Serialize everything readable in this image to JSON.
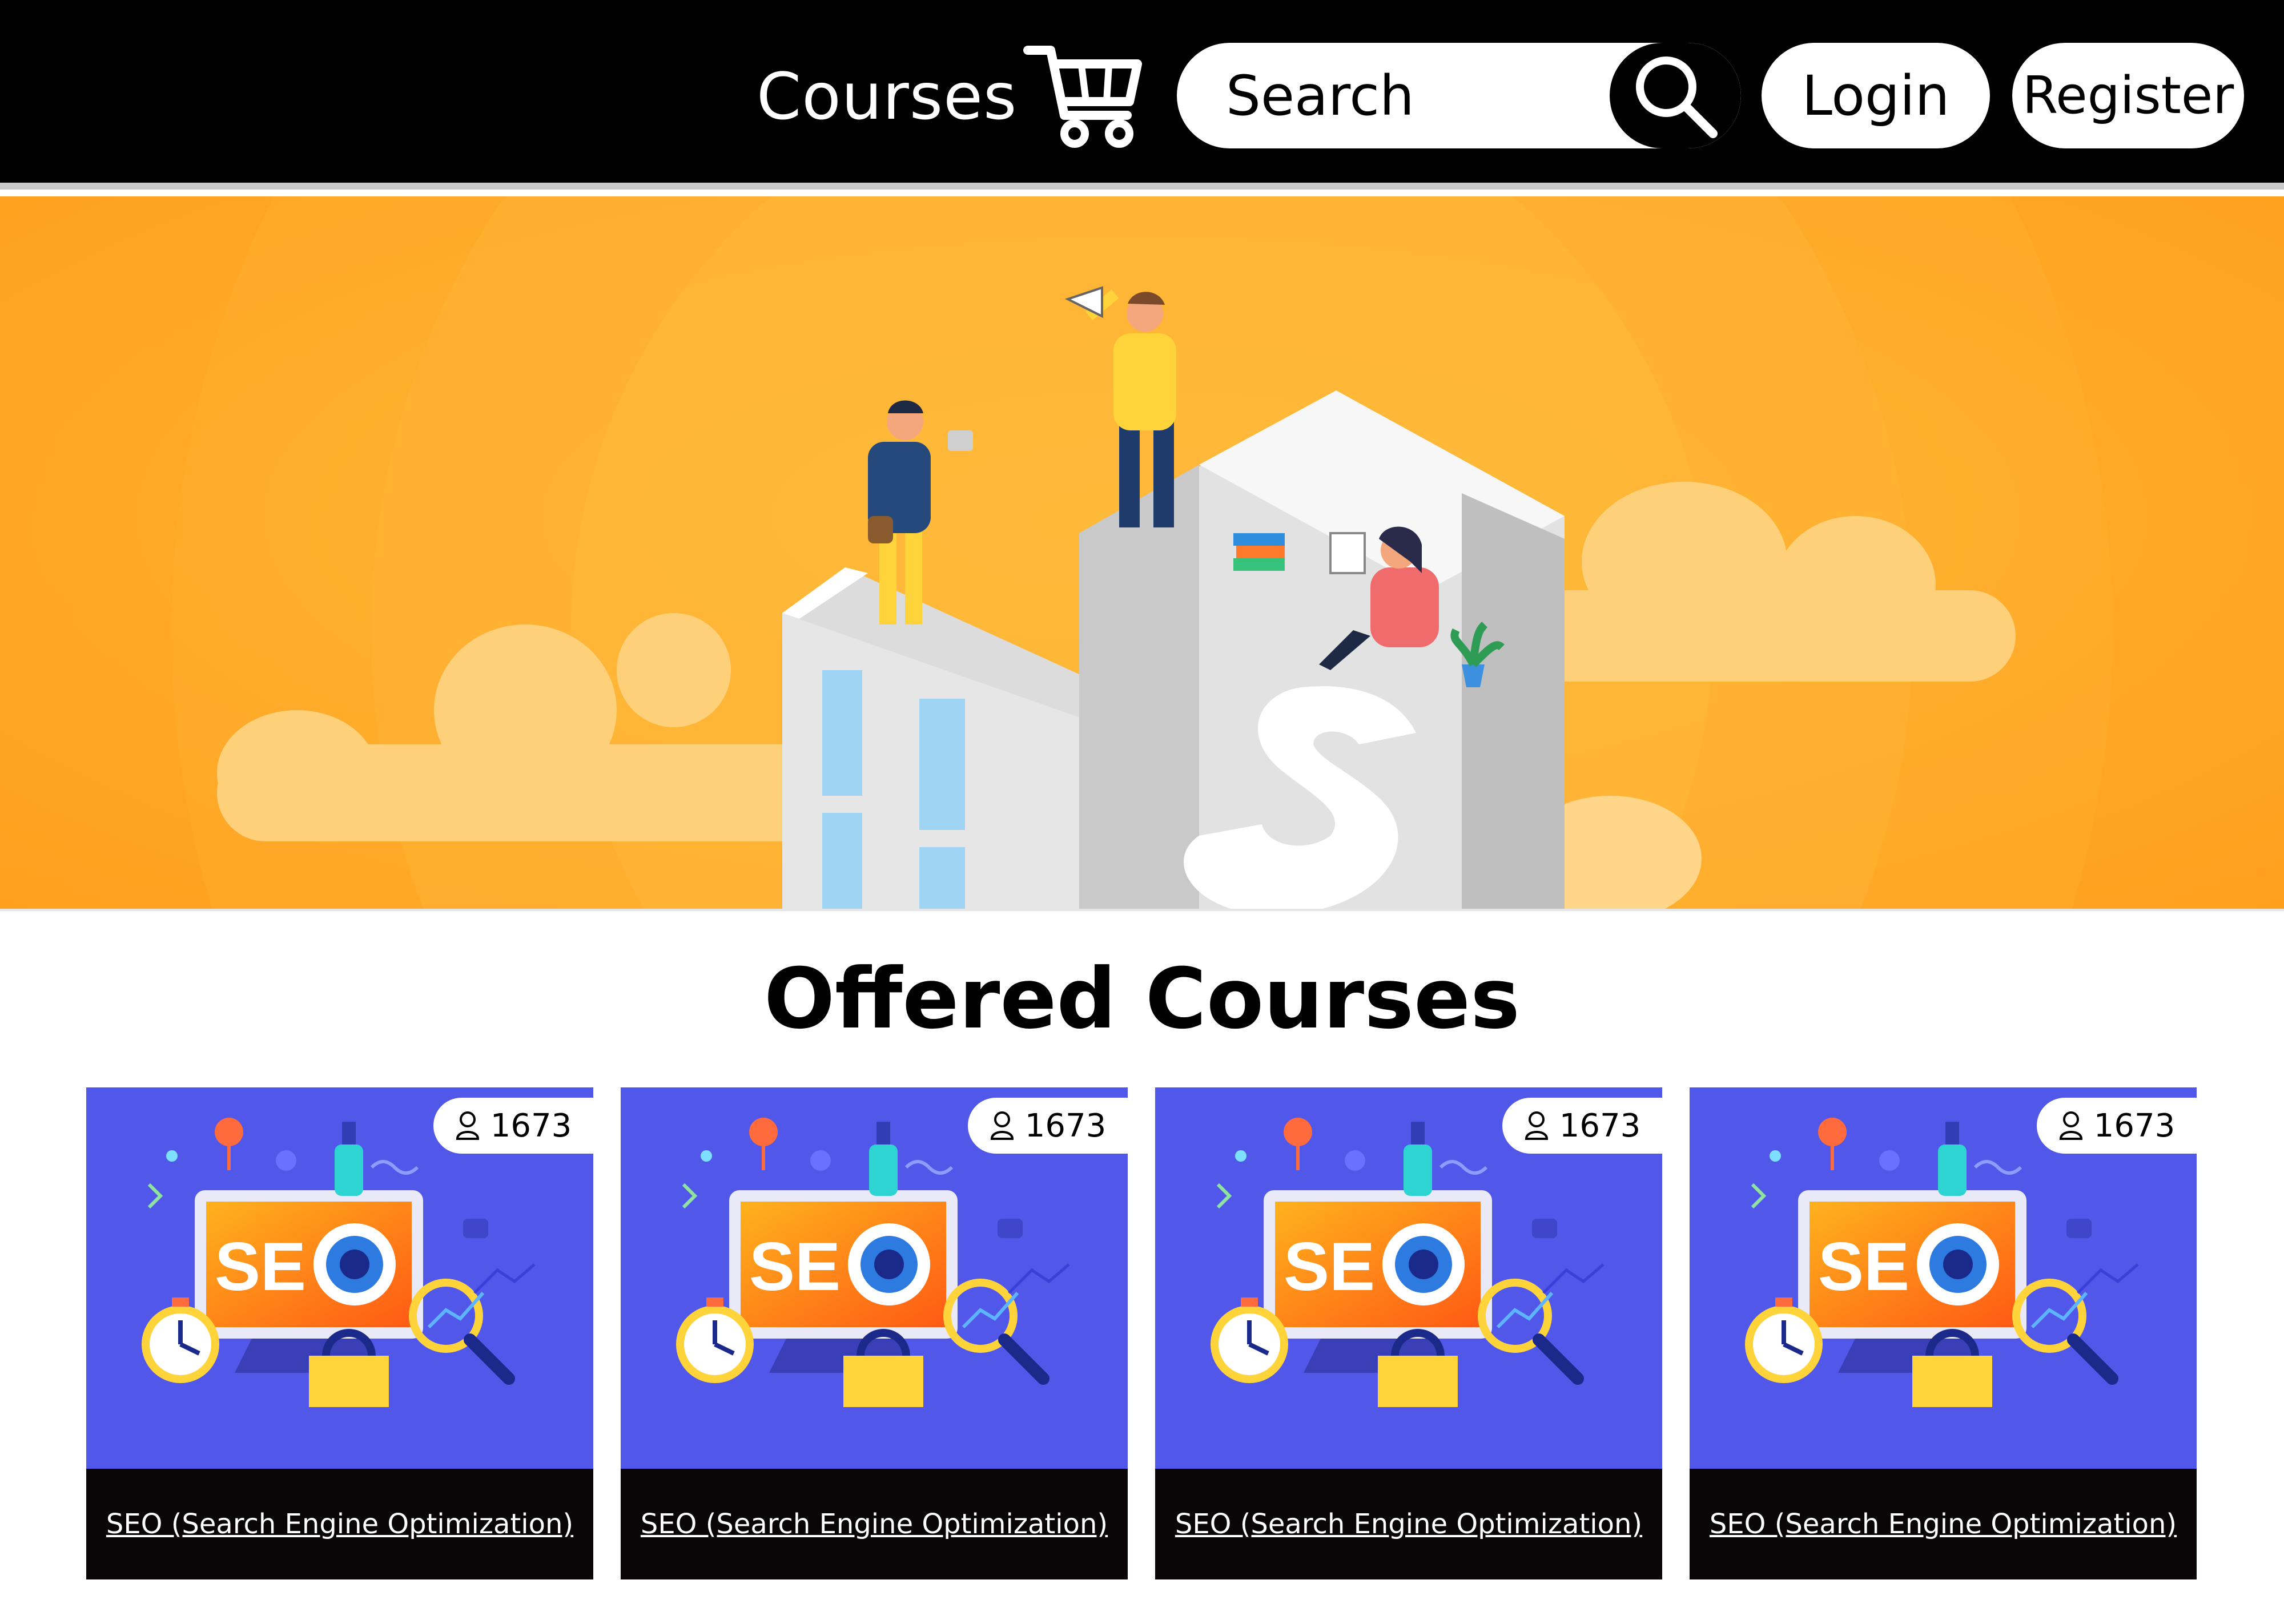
{
  "header": {
    "nav_courses": "Courses",
    "cart_icon": "cart-icon",
    "search": {
      "placeholder": "Search",
      "icon": "search-icon"
    },
    "login_label": "Login",
    "register_label": "Register"
  },
  "hero": {
    "illustration": "isometric-seo-building-with-people",
    "background_color": "#ffae2c"
  },
  "section": {
    "title": "Offered Courses"
  },
  "courses": [
    {
      "title": "SEO (Search Engine Optimization)",
      "students": "1673",
      "thumbnail": "seo-monitor-illustration"
    },
    {
      "title": "SEO (Search Engine Optimization)",
      "students": "1673",
      "thumbnail": "seo-monitor-illustration"
    },
    {
      "title": "SEO (Search Engine Optimization)",
      "students": "1673",
      "thumbnail": "seo-monitor-illustration"
    },
    {
      "title": "SEO (Search Engine Optimization)",
      "students": "1673",
      "thumbnail": "seo-monitor-illustration"
    }
  ],
  "colors": {
    "header_bg": "#000000",
    "card_bg": "#5157e8",
    "card_footer_bg": "#0a0506",
    "accent_orange": "#ffae2c"
  }
}
